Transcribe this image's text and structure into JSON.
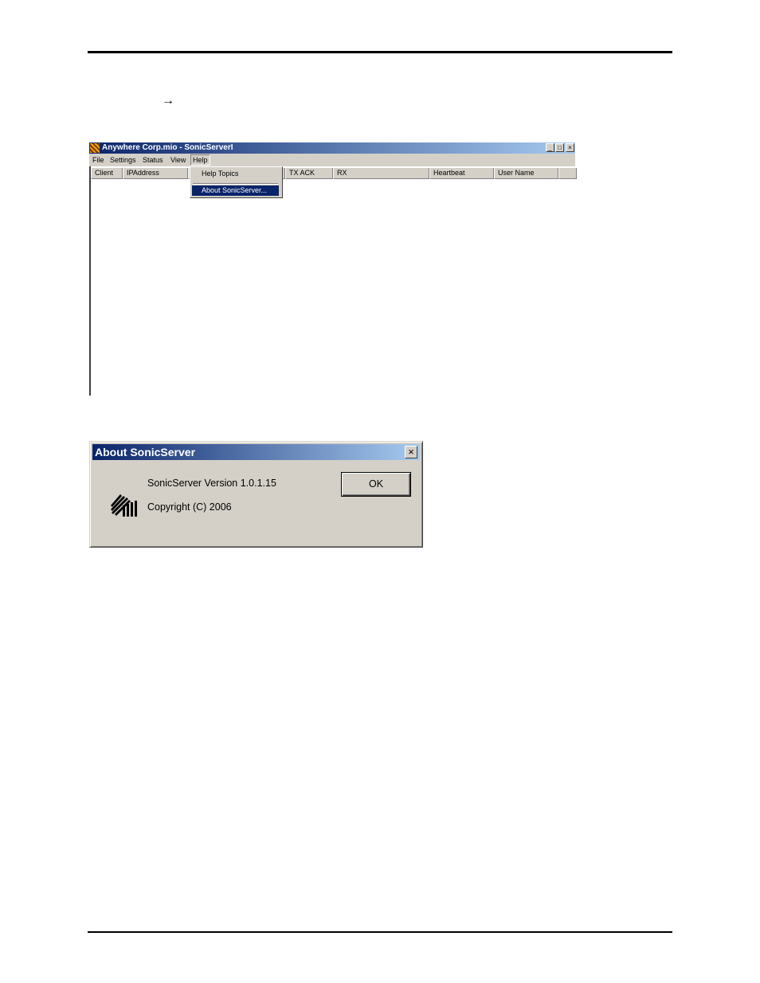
{
  "page": {
    "arrow_glyph": "→"
  },
  "app_window": {
    "title": "Anywhere Corp.mio - SonicServerI",
    "minimize_glyph": "_",
    "maximize_glyph": "□",
    "close_glyph": "×",
    "menu": [
      "File",
      "Settings",
      "Status",
      "View",
      "Help"
    ],
    "columns": [
      "Client",
      "IPAddress",
      "",
      "TX ACK",
      "RX",
      "Heartbeat",
      "User Name",
      ""
    ],
    "help_menu": {
      "items": [
        "Help Topics",
        "About SonicServer..."
      ],
      "selected": "About SonicServer..."
    }
  },
  "about_dialog": {
    "title": "About SonicServer",
    "close_glyph": "×",
    "version_text": "SonicServer Version 1.0.1.15",
    "copyright_text": "Copyright (C) 2006",
    "ok_label": "OK"
  }
}
